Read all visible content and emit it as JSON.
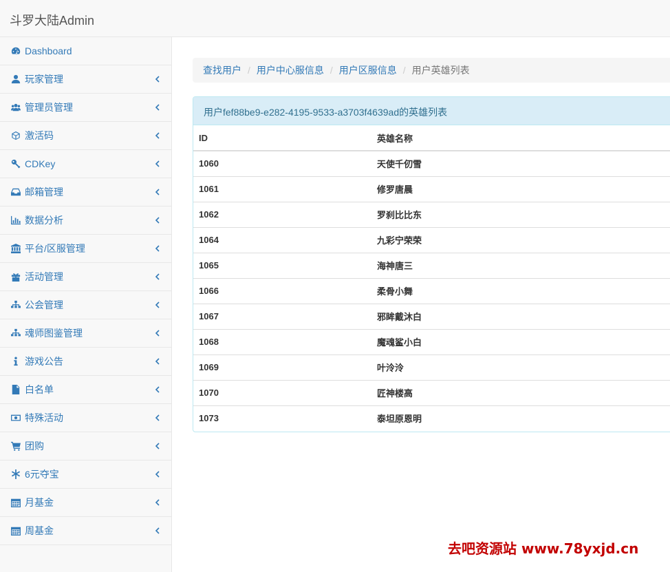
{
  "app": {
    "title": "斗罗大陆Admin"
  },
  "sidebar": {
    "items": [
      {
        "label": "Dashboard",
        "icon": "dashboard-icon",
        "has_chevron": false
      },
      {
        "label": "玩家管理",
        "icon": "user-icon",
        "has_chevron": true
      },
      {
        "label": "管理员管理",
        "icon": "users-icon",
        "has_chevron": true
      },
      {
        "label": "激活码",
        "icon": "cube-icon",
        "has_chevron": true
      },
      {
        "label": "CDKey",
        "icon": "key-icon",
        "has_chevron": true
      },
      {
        "label": "邮箱管理",
        "icon": "inbox-icon",
        "has_chevron": true
      },
      {
        "label": "数据分析",
        "icon": "bar-chart-icon",
        "has_chevron": true
      },
      {
        "label": "平台/区服管理",
        "icon": "bank-icon",
        "has_chevron": true
      },
      {
        "label": "活动管理",
        "icon": "gift-icon",
        "has_chevron": true
      },
      {
        "label": "公会管理",
        "icon": "sitemap-icon",
        "has_chevron": true
      },
      {
        "label": "魂师图鉴管理",
        "icon": "sitemap-icon",
        "has_chevron": true
      },
      {
        "label": "游戏公告",
        "icon": "info-icon",
        "has_chevron": true
      },
      {
        "label": "白名单",
        "icon": "file-icon",
        "has_chevron": true
      },
      {
        "label": "特殊活动",
        "icon": "money-icon",
        "has_chevron": true
      },
      {
        "label": "团购",
        "icon": "shopping-cart-icon",
        "has_chevron": true
      },
      {
        "label": "6元夺宝",
        "icon": "asterisk-icon",
        "has_chevron": true
      },
      {
        "label": "月基金",
        "icon": "calendar-icon",
        "has_chevron": true
      },
      {
        "label": "周基金",
        "icon": "calendar-icon",
        "has_chevron": true
      }
    ]
  },
  "breadcrumb": {
    "items": [
      "查找用户",
      "用户中心服信息",
      "用户区服信息"
    ],
    "active": "用户英雄列表",
    "separator": "/"
  },
  "panel": {
    "heading": "用户fef88be9-e282-4195-9533-a3703f4639ad的英雄列表",
    "columns": [
      "ID",
      "英雄名称"
    ],
    "rows": [
      [
        "1060",
        "天使千仞雪"
      ],
      [
        "1061",
        "修罗唐晨"
      ],
      [
        "1062",
        "罗刹比比东"
      ],
      [
        "1064",
        "九彩宁荣荣"
      ],
      [
        "1065",
        "海神唐三"
      ],
      [
        "1066",
        "柔骨小舞"
      ],
      [
        "1067",
        "邪眸戴沐白"
      ],
      [
        "1068",
        "魔魂鲨小白"
      ],
      [
        "1069",
        "叶泠泠"
      ],
      [
        "1070",
        "匠神楼高"
      ],
      [
        "1073",
        "泰坦原恩明"
      ]
    ]
  },
  "watermark": {
    "text": "去吧资源站 www.78yxjd.cn",
    "color": "#c20000"
  },
  "colors": {
    "link": "#337ab7",
    "panel_heading_bg": "#d9edf7",
    "panel_heading_text": "#31708f",
    "sidebar_bg": "#f8f8f8"
  }
}
